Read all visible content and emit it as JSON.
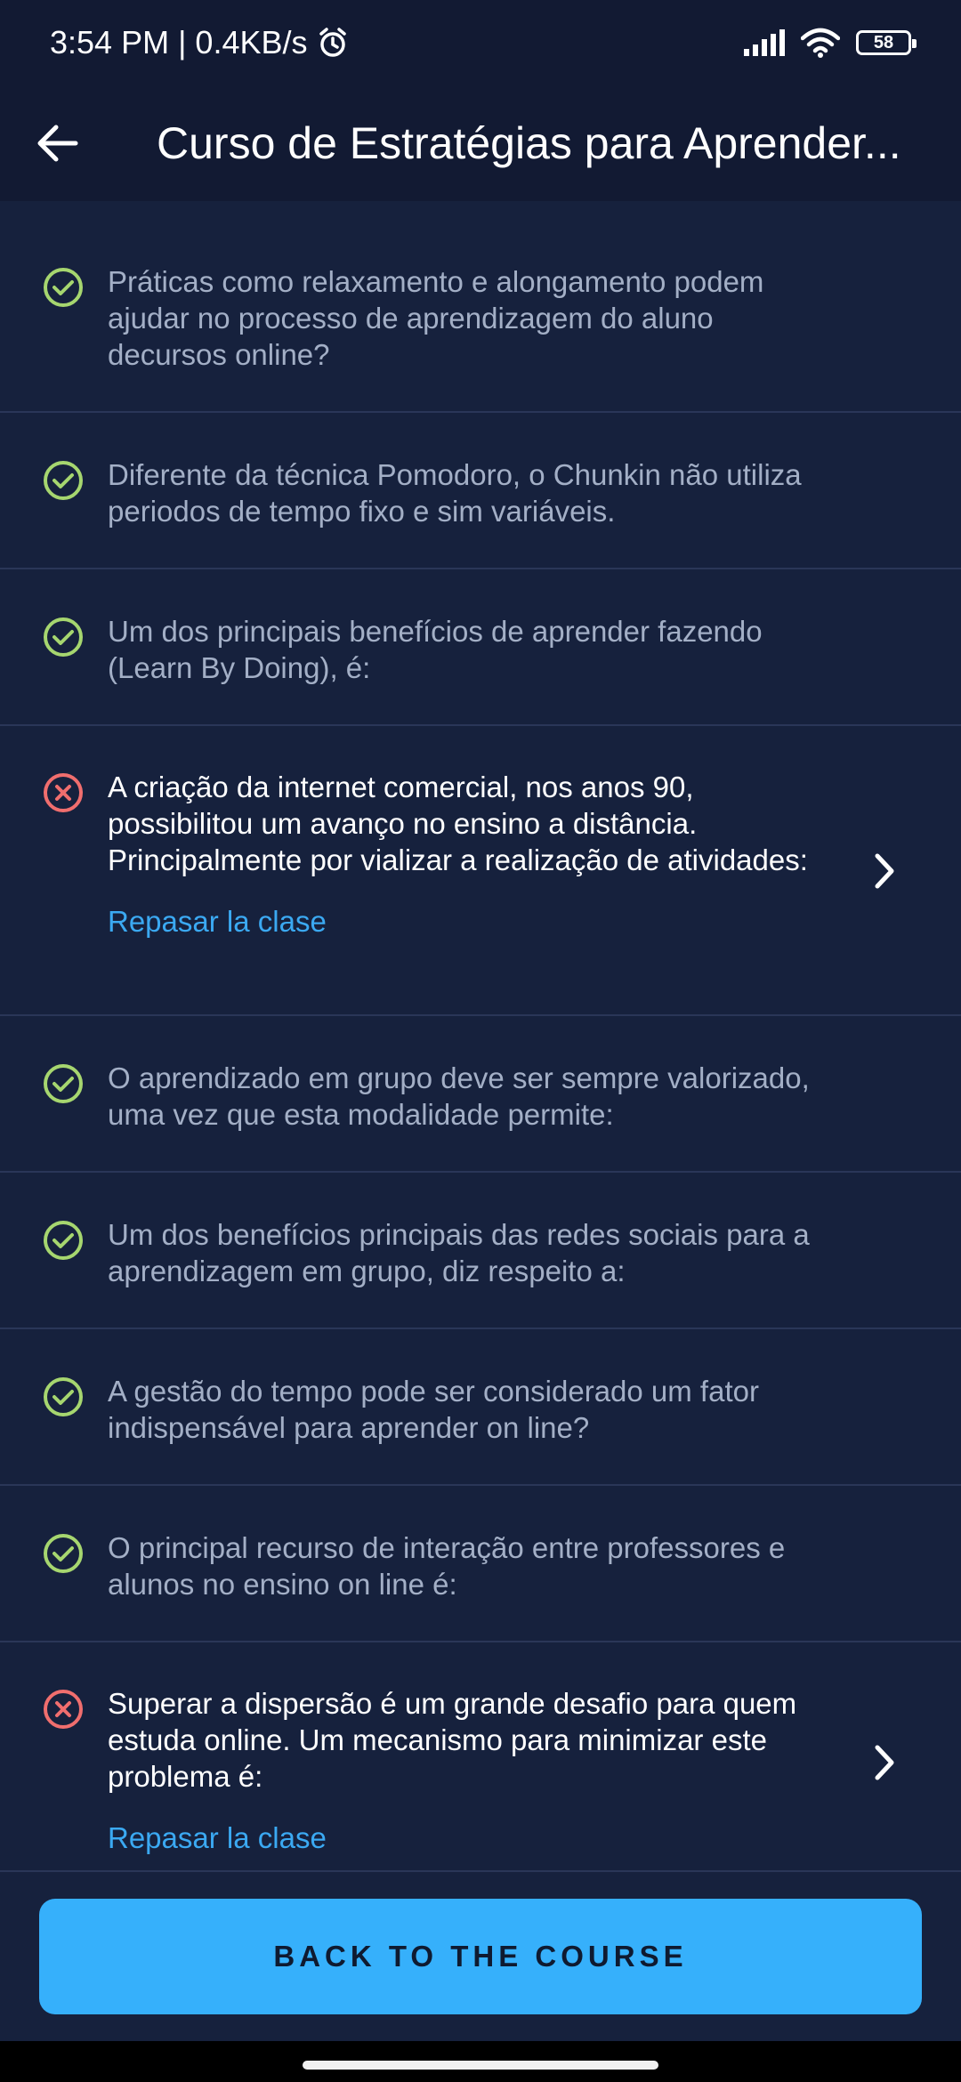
{
  "status": {
    "time_speed": "3:54 PM | 0.4KB/s",
    "battery": "58"
  },
  "header": {
    "title": "Curso de Estratégias para Aprender..."
  },
  "questions": [
    {
      "state": "correct",
      "text": "Práticas como relaxamento e alongamento podem ajudar no processo de aprendizagem do aluno decursos online?"
    },
    {
      "state": "correct",
      "text": "Diferente da técnica Pomodoro, o Chunkin não utiliza periodos de tempo fixo e sim variáveis."
    },
    {
      "state": "correct",
      "text": "Um dos principais benefícios de aprender fazendo (Learn By Doing), é:"
    },
    {
      "state": "incorrect",
      "text": "A criação da internet comercial, nos anos 90, possibilitou um avanço no ensino a distância. Principalmente por vializar a realização de atividades:",
      "review_label": "Repasar la clase"
    },
    {
      "state": "correct",
      "text": "O aprendizado em grupo deve ser sempre valorizado, uma vez que esta modalidade permite:"
    },
    {
      "state": "correct",
      "text": "Um dos benefícios principais das redes sociais para a aprendizagem em grupo, diz respeito a:"
    },
    {
      "state": "correct",
      "text": "A gestão do tempo pode ser considerado um fator indispensável para aprender on line?"
    },
    {
      "state": "correct",
      "text": "O principal recurso de interação entre professores e alunos no ensino on line é:"
    },
    {
      "state": "incorrect",
      "text": "Superar a dispersão é um grande desafio para quem estuda online. Um mecanismo para minimizar este problema é:",
      "review_label": "Repasar la clase"
    }
  ],
  "footer": {
    "cta_label": "BACK TO THE COURSE"
  },
  "colors": {
    "correct": "#a6d66f",
    "incorrect": "#f06e6e",
    "accent": "#36b0fb",
    "link": "#3ba9f2"
  }
}
